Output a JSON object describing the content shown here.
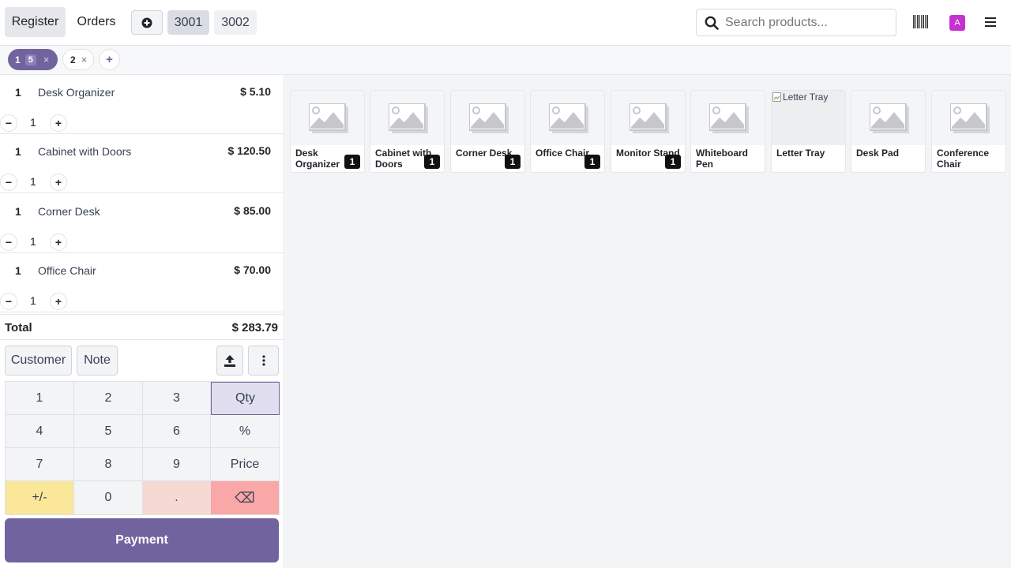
{
  "nav": {
    "register_label": "Register",
    "orders_label": "Orders",
    "add_order_icon": "plus-circle-icon",
    "order_tabs": [
      "3001",
      "3002"
    ],
    "search_placeholder": "Search products...",
    "barcode_icon": "barcode-icon",
    "avatar_letter": "A",
    "menu_icon": "hamburger-menu-icon"
  },
  "floor_orders": {
    "active": {
      "table": "1",
      "guests": "5"
    },
    "other": {
      "table": "2"
    },
    "close_symbol": "×",
    "add_symbol": "+"
  },
  "order_lines": [
    {
      "qty": "1",
      "name": "Desk Organizer",
      "price": "$ 5.10",
      "stepper_qty": "1"
    },
    {
      "qty": "1",
      "name": "Cabinet with Doors",
      "price": "$ 120.50",
      "stepper_qty": "1"
    },
    {
      "qty": "1",
      "name": "Corner Desk",
      "price": "$ 85.00",
      "stepper_qty": "1"
    },
    {
      "qty": "1",
      "name": "Office Chair",
      "price": "$ 70.00",
      "stepper_qty": "1"
    }
  ],
  "stepper": {
    "minus": "−",
    "plus": "+"
  },
  "total": {
    "label": "Total",
    "value": "$ 283.79"
  },
  "control_buttons": {
    "customer": "Customer",
    "note": "Note"
  },
  "numpad": [
    [
      "1",
      "2",
      "3",
      "Qty"
    ],
    [
      "4",
      "5",
      "6",
      "%"
    ],
    [
      "7",
      "8",
      "9",
      "Price"
    ],
    [
      "+/-",
      "0",
      ".",
      "⌫"
    ]
  ],
  "payment_label": "Payment",
  "products": [
    {
      "name": "Desk Organizer",
      "count": "1"
    },
    {
      "name": "Cabinet with Doors",
      "count": "1"
    },
    {
      "name": "Corner Desk",
      "count": "1"
    },
    {
      "name": "Office Chair",
      "count": "1"
    },
    {
      "name": "Monitor Stand",
      "count": "1"
    },
    {
      "name": "Whiteboard Pen",
      "count": ""
    },
    {
      "name": "Letter Tray",
      "count": "",
      "alt_text": "Letter Tray"
    },
    {
      "name": "Desk Pad",
      "count": ""
    },
    {
      "name": "Conference Chair",
      "count": ""
    }
  ],
  "colors": {
    "accent": "#71639e",
    "active_nav": "#e6e7eb",
    "avatar": "#c532d0",
    "qty_key": "#e1dfef",
    "plusminus_key": "#fbe79a",
    "dot_key": "#f7d9d4",
    "backspace_key": "#f9a7a7"
  }
}
